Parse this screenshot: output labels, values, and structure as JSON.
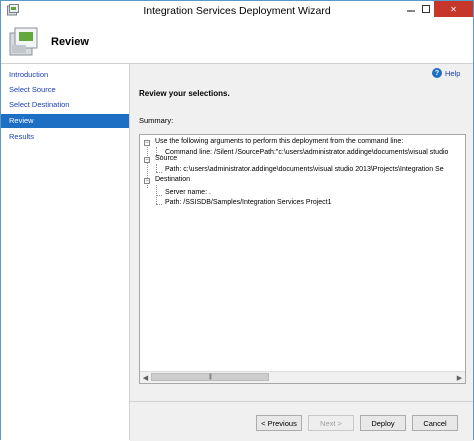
{
  "window": {
    "title": "Integration Services Deployment Wizard",
    "controls": {
      "close": "✕"
    }
  },
  "header": {
    "title": "Review"
  },
  "nav": {
    "items": [
      {
        "label": "Introduction"
      },
      {
        "label": "Select Source"
      },
      {
        "label": "Select Destination"
      },
      {
        "label": "Review",
        "active": true
      },
      {
        "label": "Results"
      }
    ]
  },
  "help": {
    "label": "Help"
  },
  "main": {
    "heading": "Review your selections.",
    "summary_label": "Summary:",
    "tree": {
      "root_arguments": "Use the following arguments to perform this deployment from the command line:",
      "command_line": "Command line: /Silent /SourcePath:\"c:\\users\\administrator.addinge\\documents\\visual studio",
      "source": "Source",
      "source_path": "Path: c:\\users\\administrator.addinge\\documents\\visual studio 2013\\Projects\\Integration Se",
      "destination": "Destination",
      "server_name": "Server name: .",
      "dest_path": "Path: /SSISDB/Samples/Integration Services Project1",
      "expander_symbol": "−"
    }
  },
  "footer": {
    "previous": "< Previous",
    "next": "Next >",
    "deploy": "Deploy",
    "cancel": "Cancel"
  },
  "colors": {
    "accent": "#1d6fc4",
    "close_button": "#c7362b",
    "link": "#1c3fb0"
  }
}
